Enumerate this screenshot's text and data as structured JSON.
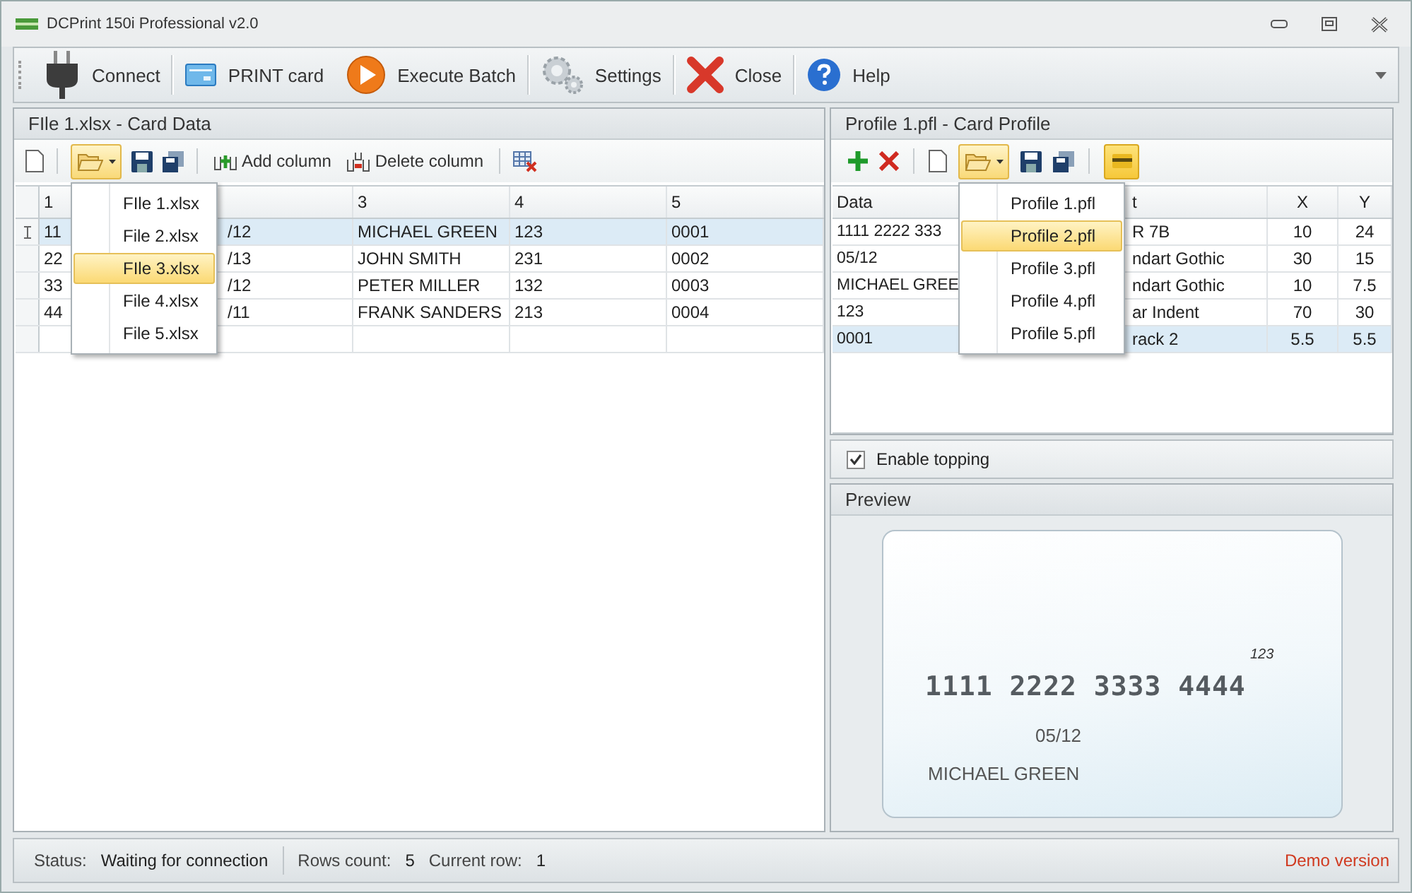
{
  "window": {
    "title": "DCPrint 150i Professional v2.0"
  },
  "toolbar": [
    {
      "label": "Connect"
    },
    {
      "label": "PRINT card"
    },
    {
      "label": "Execute Batch"
    },
    {
      "label": "Settings"
    },
    {
      "label": "Close"
    },
    {
      "label": "Help"
    }
  ],
  "card_data": {
    "title": "FIle 1.xlsx - Card Data",
    "buttons": [
      "Add column",
      "Delete column"
    ],
    "open_menu": [
      {
        "label": "FIle 1.xlsx",
        "selected": false
      },
      {
        "label": "File 2.xlsx",
        "selected": false
      },
      {
        "label": "FIle 3.xlsx",
        "selected": true
      },
      {
        "label": "File 4.xlsx",
        "selected": false
      },
      {
        "label": "File 5.xlsx",
        "selected": false
      }
    ],
    "table": {
      "columns": {
        "column_1": "1",
        "column_3": "3",
        "column_4": "4",
        "column_5": "5"
      },
      "rows": [
        {
          "selected": true,
          "cells": [
            "11",
            "/12",
            "MICHAEL GREEN",
            "123",
            "0001"
          ]
        },
        {
          "selected": false,
          "cells": [
            "22",
            "/13",
            "JOHN SMITH",
            "231",
            "0002"
          ]
        },
        {
          "selected": false,
          "cells": [
            "33",
            "/12",
            "PETER MILLER",
            "132",
            "0003"
          ]
        },
        {
          "selected": false,
          "cells": [
            "44",
            "/11",
            "FRANK SANDERS",
            "213",
            "0004"
          ]
        }
      ]
    }
  },
  "card_profile": {
    "title": "Profile 1.pfl - Card Profile",
    "card_button": {
      "pressed": true
    },
    "open_menu": [
      {
        "label": "Profile 1.pfl",
        "selected": false
      },
      {
        "label": "Profile 2.pfl",
        "selected": true
      },
      {
        "label": "Profile 3.pfl",
        "selected": false
      },
      {
        "label": "Profile 4.pfl",
        "selected": false
      },
      {
        "label": "Profile 5.pfl",
        "selected": false
      }
    ],
    "table": {
      "columns": {
        "column_1": "Data",
        "column_2": "t",
        "column_3": "X",
        "column_4": "Y"
      },
      "rows": [
        {
          "selected": false,
          "cells": [
            "1111 2222 333",
            "R 7B",
            "10",
            "24"
          ]
        },
        {
          "selected": false,
          "cells": [
            "05/12",
            "ndart Gothic",
            "30",
            "15"
          ]
        },
        {
          "selected": false,
          "cells": [
            "MICHAEL GREE",
            "ndart Gothic",
            "10",
            "7.5"
          ]
        },
        {
          "selected": false,
          "cells": [
            "123",
            "ar Indent",
            "70",
            "30"
          ]
        },
        {
          "selected": true,
          "cells": [
            "0001",
            "rack 2",
            "5.5",
            "5.5"
          ]
        }
      ]
    },
    "enable_topping": {
      "label": "Enable topping",
      "checked": true
    }
  },
  "preview": {
    "title": "Preview",
    "card": {
      "cvv": "123",
      "number": "1111 2222 3333 4444",
      "expiry": "05/12",
      "name": "MICHAEL GREEN"
    }
  },
  "status_bar": {
    "status_label": "Status:",
    "status": "Waiting for connection",
    "rows_label": "Rows count:",
    "rows": "5",
    "current_label": "Current row:",
    "current": "1",
    "edition": "Demo version"
  }
}
